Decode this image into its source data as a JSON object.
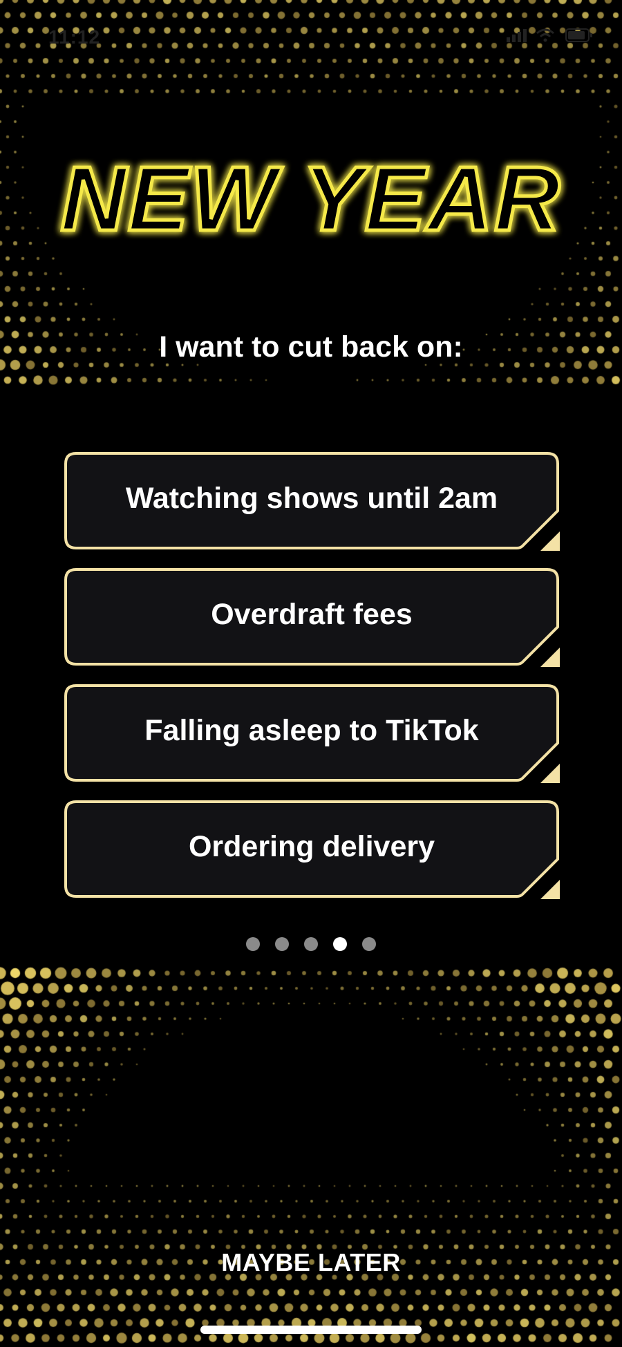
{
  "status_bar": {
    "time": "11:12"
  },
  "headline": "NEW YEAR",
  "subtitle": "I want to cut back on:",
  "options": [
    {
      "label": "Watching shows until 2am"
    },
    {
      "label": "Overdraft fees"
    },
    {
      "label": "Falling asleep to TikTok"
    },
    {
      "label": "Ordering delivery"
    }
  ],
  "pager": {
    "total": 5,
    "active_index": 3
  },
  "maybe_later": "MAYBE LATER",
  "colors": {
    "background": "#000000",
    "neon_yellow": "#f5e94a",
    "option_border": "#f4e2a6",
    "option_fill": "#121215",
    "dot_gold": "#c8a86a",
    "pager_inactive": "#8a8a8a",
    "pager_active": "#ffffff"
  },
  "icons": {
    "signal": "signal-icon",
    "wifi": "wifi-icon",
    "battery": "battery-icon"
  }
}
